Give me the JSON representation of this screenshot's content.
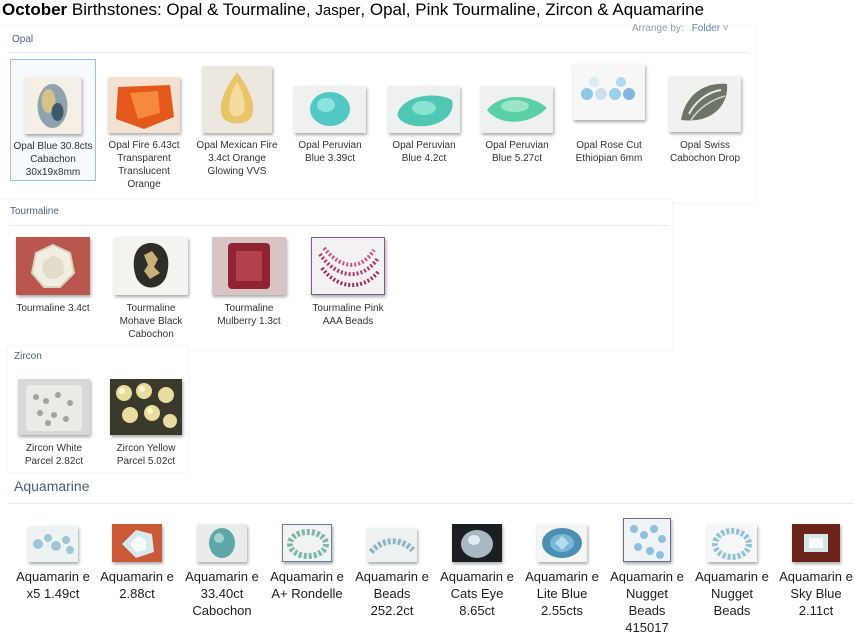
{
  "header": {
    "month": "October",
    "rest_1": " Birthstones:  Opal & Tourmaline, ",
    "jasper": "Jasper",
    "rest_2": ", Opal, Pink Tourmaline, Zircon & Aquamarine"
  },
  "opal": {
    "label": "Opal",
    "arrange_label": "Arrange by:",
    "arrange_value": "Folder",
    "arrange_chevron": "˅",
    "items": [
      {
        "caption": "Opal Blue 30.8cts Cabachon 30x19x8mm",
        "icon": "opal-blue-image"
      },
      {
        "caption": "Opal Fire  6.43ct Transparent Translucent Orange",
        "icon": "opal-fire-image"
      },
      {
        "caption": "Opal Mexican Fire 3.4ct Orange Glowing VVS",
        "icon": "opal-mexican-image"
      },
      {
        "caption": "Opal Peruvian Blue 3.39ct",
        "icon": "opal-peruvian-image"
      },
      {
        "caption": "Opal Peruvian Blue 4.2ct",
        "icon": "opal-peruvian-image"
      },
      {
        "caption": "Opal Peruvian Blue 5.27ct",
        "icon": "opal-peruvian-image"
      },
      {
        "caption": "Opal Rose Cut Ethiopian 6mm",
        "icon": "opal-rose-image"
      },
      {
        "caption": "Opal Swiss Cabochon Drop",
        "icon": "opal-swiss-image"
      }
    ]
  },
  "tourmaline": {
    "label": "Tourmaline",
    "items": [
      {
        "caption": "Tourmaline 3.4ct",
        "icon": "tourmaline-image"
      },
      {
        "caption": "Tourmaline Mohave Black Cabochon",
        "icon": "tourmaline-mohave-image"
      },
      {
        "caption": "Tourmaline Mulberry 1.3ct",
        "icon": "tourmaline-mulberry-image"
      },
      {
        "caption": "Tourmaline Pink AAA Beads",
        "icon": "tourmaline-beads-image"
      }
    ]
  },
  "zircon": {
    "label": "Zircon",
    "items": [
      {
        "caption": "Zircon White Parcel 2.82ct",
        "icon": "zircon-white-image"
      },
      {
        "caption": "Zircon Yellow Parcel 5.02ct",
        "icon": "zircon-yellow-image"
      }
    ]
  },
  "aquamarine": {
    "label": "Aquamarine",
    "items": [
      {
        "caption": "Aquamarin e  x5 1.49ct"
      },
      {
        "caption": "Aquamarin e 2.88ct"
      },
      {
        "caption": "Aquamarin e 33.40ct Cabochon"
      },
      {
        "caption": "Aquamarin e A+ Rondelle"
      },
      {
        "caption": "Aquamarin e Beads 252.2ct"
      },
      {
        "caption": "Aquamarin e Cats Eye 8.65ct"
      },
      {
        "caption": "Aquamarin e Lite Blue 2.55cts"
      },
      {
        "caption": "Aquamarin e Nugget Beads 415017"
      },
      {
        "caption": "Aquamarin e Nugget Beads"
      },
      {
        "caption": "Aquamarin e Sky Blue 2.11ct"
      }
    ]
  }
}
